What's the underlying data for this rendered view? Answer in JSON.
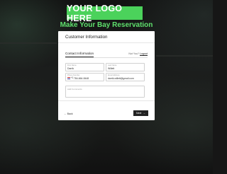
{
  "logo": {
    "text": "YOUR LOGO HERE"
  },
  "page": {
    "heading": "Make Your Bay Reservation"
  },
  "card": {
    "title": "Customer Information",
    "tabs": [
      {
        "label": "Contact Information"
      }
    ],
    "not_you_text": "Not You?",
    "logout_label": "Logout",
    "fields": {
      "first_name": {
        "label": "First Name",
        "value": "Darrik"
      },
      "last_name": {
        "label": "Last Name",
        "value": "Willett"
      },
      "phone": {
        "label": "Phone Number",
        "prefix": "+1",
        "value": "784-664-8448"
      },
      "email": {
        "label": "Email Address",
        "value": "darrik.willett@gmail.com"
      },
      "comments": {
        "placeholder": "Add Comments"
      }
    }
  },
  "nav": {
    "back_label": "Back",
    "next_label": "Next"
  },
  "colors": {
    "accent": "#4bd25b",
    "heading": "#5fe06d"
  },
  "icons": {
    "back": "arrow-left-icon",
    "next": "arrow-right-icon"
  }
}
